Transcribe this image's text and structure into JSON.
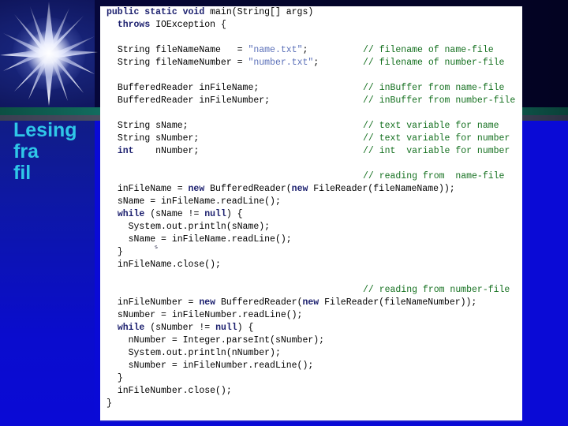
{
  "slide": {
    "title_lines": [
      "Lesing",
      "fra",
      "fil"
    ],
    "title_color": "#2fc7e8",
    "background_color": "#0a0ad6",
    "panel_background": "#ffffff",
    "star_icon": "starburst-icon",
    "artifact_glyph": "s"
  },
  "code": {
    "language": "java",
    "keyword_color": "#1b1f6e",
    "string_color": "#5a6fb8",
    "comment_color": "#14701f",
    "text_color": "#000000",
    "lines": [
      {
        "indent": 0,
        "tokens": [
          {
            "t": "kw",
            "v": "public static void "
          },
          {
            "t": "plain",
            "v": "main(String[] args)"
          }
        ]
      },
      {
        "indent": 1,
        "tokens": [
          {
            "t": "kw",
            "v": "throws "
          },
          {
            "t": "plain",
            "v": "IOException {"
          }
        ]
      },
      {
        "indent": 0,
        "tokens": []
      },
      {
        "indent": 1,
        "tokens": [
          {
            "t": "plain",
            "v": "String fileNameName   = "
          },
          {
            "t": "str",
            "v": "\"name.txt\""
          },
          {
            "t": "plain",
            "v": ";"
          }
        ],
        "tail": {
          "t": "cmt",
          "v": "// filename of name-file"
        }
      },
      {
        "indent": 1,
        "tokens": [
          {
            "t": "plain",
            "v": "String fileNameNumber = "
          },
          {
            "t": "str",
            "v": "\"number.txt\""
          },
          {
            "t": "plain",
            "v": ";"
          }
        ],
        "tail": {
          "t": "cmt",
          "v": "// filename of number-file"
        }
      },
      {
        "indent": 0,
        "tokens": []
      },
      {
        "indent": 1,
        "tokens": [
          {
            "t": "plain",
            "v": "BufferedReader inFileName;"
          }
        ],
        "tail": {
          "t": "cmt",
          "v": "// inBuffer from name-file"
        }
      },
      {
        "indent": 1,
        "tokens": [
          {
            "t": "plain",
            "v": "BufferedReader inFileNumber;"
          }
        ],
        "tail": {
          "t": "cmt",
          "v": "// inBuffer from number-file"
        }
      },
      {
        "indent": 0,
        "tokens": []
      },
      {
        "indent": 1,
        "tokens": [
          {
            "t": "plain",
            "v": "String sName;"
          }
        ],
        "tail": {
          "t": "cmt",
          "v": "// text variable for name"
        }
      },
      {
        "indent": 1,
        "tokens": [
          {
            "t": "plain",
            "v": "String sNumber;"
          }
        ],
        "tail": {
          "t": "cmt",
          "v": "// text variable for number"
        }
      },
      {
        "indent": 1,
        "tokens": [
          {
            "t": "kw",
            "v": "int"
          },
          {
            "t": "plain",
            "v": "    nNumber;"
          }
        ],
        "tail": {
          "t": "cmt",
          "v": "// int  variable for number"
        }
      },
      {
        "indent": 0,
        "tokens": []
      },
      {
        "indent": 0,
        "tokens": [],
        "tail": {
          "t": "cmt",
          "v": "// reading from  name-file"
        }
      },
      {
        "indent": 1,
        "tokens": [
          {
            "t": "plain",
            "v": "inFileName = "
          },
          {
            "t": "kw",
            "v": "new "
          },
          {
            "t": "plain",
            "v": "BufferedReader("
          },
          {
            "t": "kw",
            "v": "new "
          },
          {
            "t": "plain",
            "v": "FileReader(fileNameName));"
          }
        ]
      },
      {
        "indent": 1,
        "tokens": [
          {
            "t": "plain",
            "v": "sName = inFileName.readLine();"
          }
        ]
      },
      {
        "indent": 1,
        "tokens": [
          {
            "t": "kw",
            "v": "while "
          },
          {
            "t": "plain",
            "v": "(sName != "
          },
          {
            "t": "kw",
            "v": "null"
          },
          {
            "t": "plain",
            "v": ") {"
          }
        ]
      },
      {
        "indent": 2,
        "tokens": [
          {
            "t": "plain",
            "v": "System.out.println(sName);"
          }
        ]
      },
      {
        "indent": 2,
        "tokens": [
          {
            "t": "plain",
            "v": "sName = inFileName.readLine();"
          }
        ]
      },
      {
        "indent": 1,
        "tokens": [
          {
            "t": "plain",
            "v": "}"
          }
        ]
      },
      {
        "indent": 1,
        "tokens": [
          {
            "t": "plain",
            "v": "inFileName.close();"
          }
        ]
      },
      {
        "indent": 0,
        "tokens": []
      },
      {
        "indent": 0,
        "tokens": [],
        "tail": {
          "t": "cmt",
          "v": "// reading from number-file"
        }
      },
      {
        "indent": 1,
        "tokens": [
          {
            "t": "plain",
            "v": "inFileNumber = "
          },
          {
            "t": "kw",
            "v": "new "
          },
          {
            "t": "plain",
            "v": "BufferedReader("
          },
          {
            "t": "kw",
            "v": "new "
          },
          {
            "t": "plain",
            "v": "FileReader(fileNameNumber));"
          }
        ]
      },
      {
        "indent": 1,
        "tokens": [
          {
            "t": "plain",
            "v": "sNumber = inFileNumber.readLine();"
          }
        ]
      },
      {
        "indent": 1,
        "tokens": [
          {
            "t": "kw",
            "v": "while "
          },
          {
            "t": "plain",
            "v": "(sNumber != "
          },
          {
            "t": "kw",
            "v": "null"
          },
          {
            "t": "plain",
            "v": ") {"
          }
        ]
      },
      {
        "indent": 2,
        "tokens": [
          {
            "t": "plain",
            "v": "nNumber = Integer.parseInt(sNumber);"
          }
        ]
      },
      {
        "indent": 2,
        "tokens": [
          {
            "t": "plain",
            "v": "System.out.println(nNumber);"
          }
        ]
      },
      {
        "indent": 2,
        "tokens": [
          {
            "t": "plain",
            "v": "sNumber = inFileNumber.readLine();"
          }
        ]
      },
      {
        "indent": 1,
        "tokens": [
          {
            "t": "plain",
            "v": "}"
          }
        ]
      },
      {
        "indent": 1,
        "tokens": [
          {
            "t": "plain",
            "v": "inFileNumber.close();"
          }
        ]
      },
      {
        "indent": 0,
        "tokens": [
          {
            "t": "plain",
            "v": "}"
          }
        ]
      }
    ]
  }
}
